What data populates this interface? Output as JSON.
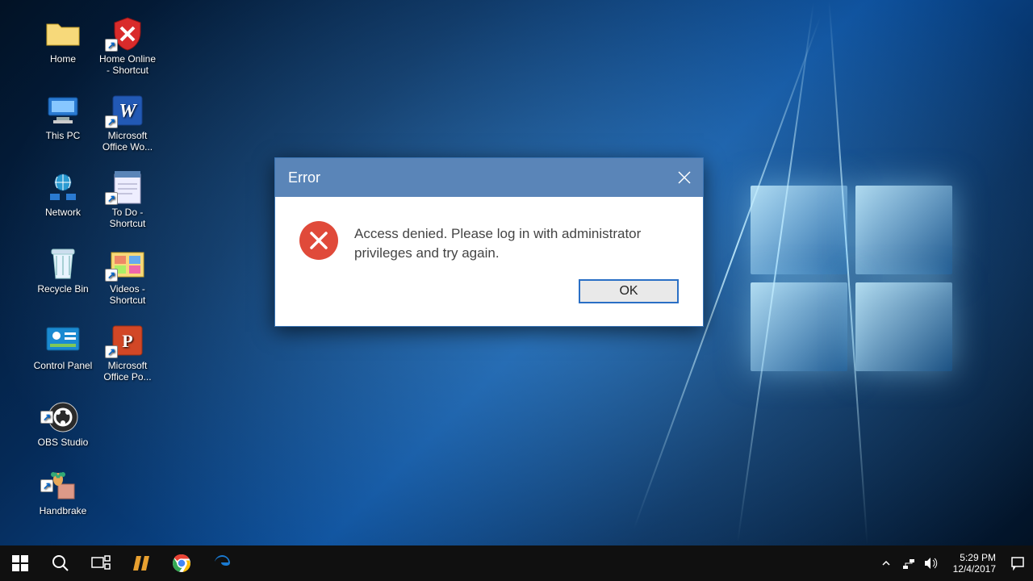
{
  "desktop": {
    "icons": [
      {
        "label": "Home"
      },
      {
        "label": "Home Online - Shortcut"
      },
      {
        "label": "This PC"
      },
      {
        "label": "Microsoft Office Wo..."
      },
      {
        "label": "Network"
      },
      {
        "label": "To Do - Shortcut"
      },
      {
        "label": "Recycle Bin"
      },
      {
        "label": "Videos - Shortcut"
      },
      {
        "label": "Control Panel"
      },
      {
        "label": "Microsoft Office Po..."
      },
      {
        "label": "OBS Studio"
      },
      {
        "label": "Handbrake"
      }
    ]
  },
  "dialog": {
    "title": "Error",
    "message": "Access denied. Please log in with administrator privileges and try again.",
    "ok_label": "OK"
  },
  "taskbar": {
    "buttons": [
      "start",
      "search",
      "task-view",
      "winamp",
      "chrome",
      "edge"
    ]
  },
  "tray": {
    "time": "5:29 PM",
    "date": "12/4/2017"
  }
}
